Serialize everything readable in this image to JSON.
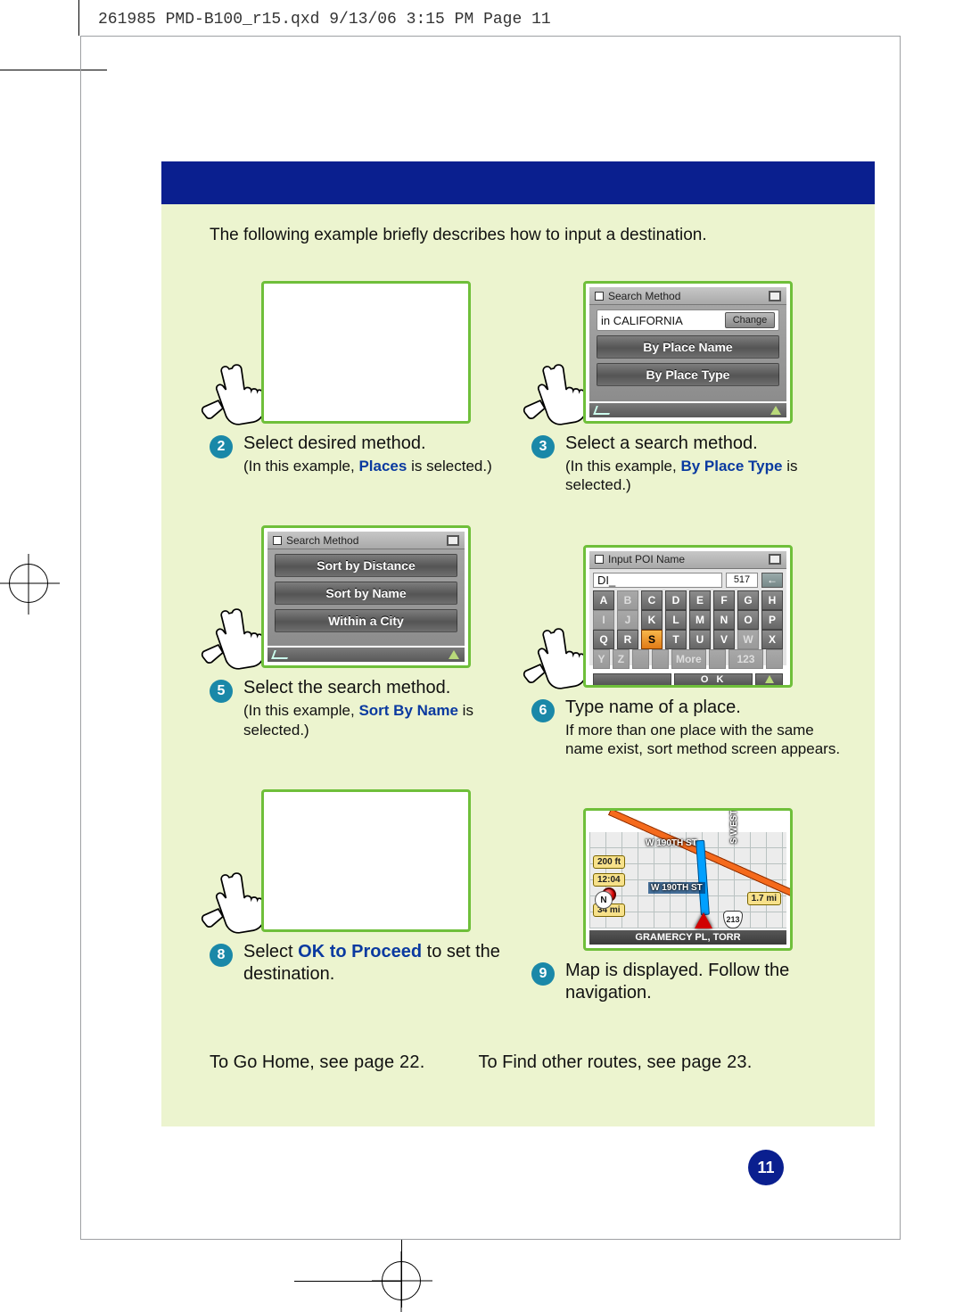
{
  "slugline": "261985 PMD-B100_r15.qxd  9/13/06  3:15 PM  Page 11",
  "intro": "The following example briefly describes how to input a destination.",
  "steps": {
    "s2": {
      "num": "2",
      "title": "Select desired method.",
      "subPre": "(In this example, ",
      "kw": "Places",
      "subPost": " is selected.)"
    },
    "s3": {
      "num": "3",
      "title": "Select a search method.",
      "subPre": "(In this example, ",
      "kw": "By Place Type",
      "subPost": " is selected.)",
      "titlebar": "Search Method",
      "stateLabel": "in CALIFORNIA",
      "changeBtn": "Change",
      "row1": "By Place Name",
      "row2": "By Place Type"
    },
    "s5": {
      "num": "5",
      "title": "Select the search method.",
      "subPre": "(In this example, ",
      "kw": "Sort By Name",
      "subPost": " is selected.)",
      "titlebar": "Search Method",
      "row1": "Sort by Distance",
      "row2": "Sort by Name",
      "row3": "Within a City"
    },
    "s6": {
      "num": "6",
      "title": "Type name of a place.",
      "sub": "If more than one place with the same name exist, sort method screen appears.",
      "titlebar": "Input POI Name",
      "entry": "DI_",
      "count": "517",
      "rows": [
        [
          "A",
          "B",
          "C",
          "D",
          "E",
          "F",
          "G",
          "H"
        ],
        [
          "I",
          "J",
          "K",
          "L",
          "M",
          "N",
          "O",
          "P"
        ],
        [
          "Q",
          "R",
          "S",
          "T",
          "U",
          "V",
          "W",
          "X"
        ],
        [
          "Y",
          "Z",
          "",
          "",
          "More",
          "",
          "123",
          ""
        ]
      ],
      "ok": "O K"
    },
    "s8": {
      "num": "8",
      "titlePre": "Select ",
      "kw": "OK to Proceed",
      "titlePost": " to set the destination."
    },
    "s9": {
      "num": "9",
      "title": "Map is displayed. Follow the navigation.",
      "street1": "W 190TH ST",
      "street2": "W 190TH ST",
      "pill1": "200 ft",
      "pill2": "12:04",
      "pill3": "34 mi",
      "pill4": "1.7 mi",
      "stern": "S WESTERN AVE",
      "shield": "213",
      "result": "GRAMERCY PL, TORR"
    }
  },
  "links": {
    "homePre": "To Go Home, ",
    "homeSee": "see page 22.",
    "otherPre": "To Find other routes, ",
    "otherSee": "see page 23."
  },
  "pageNumber": "11"
}
